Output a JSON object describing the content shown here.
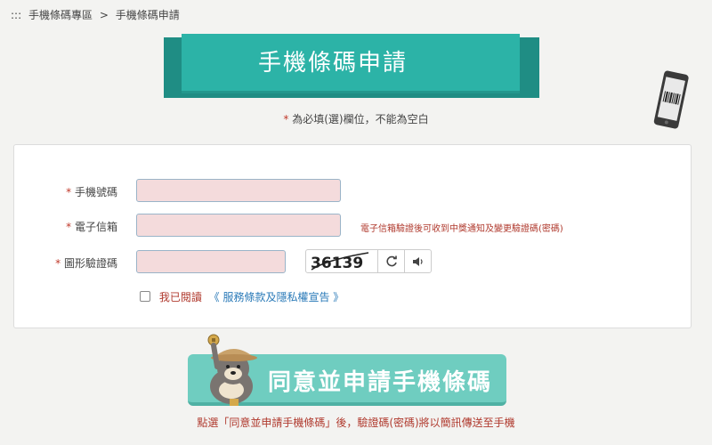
{
  "breadcrumb": {
    "prefix": ":::",
    "parent": "手機條碼專區",
    "separator": ">",
    "current": "手機條碼申請"
  },
  "banner": {
    "title": "手機條碼申請"
  },
  "required_note": {
    "star": "*",
    "text": "為必填(選)欄位，不能為空白"
  },
  "form": {
    "phone": {
      "star": "*",
      "label": "手機號碼",
      "value": "",
      "placeholder": ""
    },
    "email": {
      "star": "*",
      "label": "電子信箱",
      "value": "",
      "placeholder": "",
      "hint": "電子信箱驗證後可收到中獎通知及變更驗證碼(密碼)"
    },
    "captcha": {
      "star": "*",
      "label": "圖形驗證碼",
      "value": "",
      "placeholder": "",
      "image_text": "36139"
    },
    "agree": {
      "label": "我已閱讀",
      "link": "《 服務條款及隱私權宣告 》"
    }
  },
  "submit": {
    "label": "同意並申請手機條碼"
  },
  "footer_note": "點選「同意並申請手機條碼」後，驗證碼(密碼)將以簡訊傳送至手機",
  "colors": {
    "accent": "#2cb3a7",
    "button": "#6fcdc0",
    "required": "#c0392b",
    "field_bg": "#f4dbdc",
    "link": "#2a7ab8"
  },
  "icons": {
    "refresh": "refresh-icon",
    "audio": "speaker-icon",
    "phone": "phone-barcode-icon",
    "mascot": "bear-mascot-icon"
  }
}
